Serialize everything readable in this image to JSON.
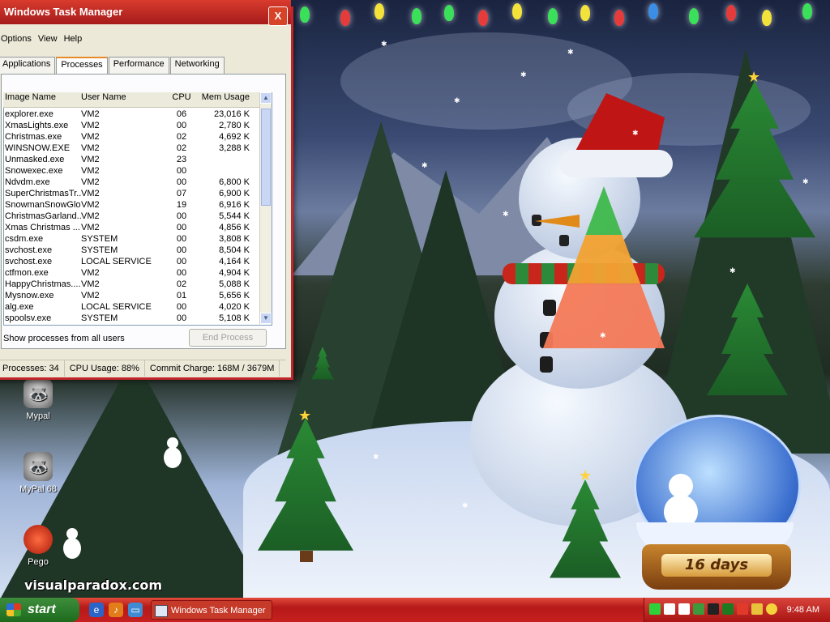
{
  "window": {
    "title": "Windows Task Manager",
    "close_label": "X",
    "menu": [
      "Options",
      "View",
      "Help"
    ],
    "tabs": [
      "Applications",
      "Processes",
      "Performance",
      "Networking"
    ],
    "active_tab": "Processes",
    "columns": {
      "name": "Image Name",
      "user": "User Name",
      "cpu": "CPU",
      "mem": "Mem Usage"
    },
    "processes": [
      {
        "name": "explorer.exe",
        "user": "VM2",
        "cpu": "06",
        "mem": "23,016 K"
      },
      {
        "name": "XmasLights.exe",
        "user": "VM2",
        "cpu": "00",
        "mem": "2,780 K"
      },
      {
        "name": "Christmas.exe",
        "user": "VM2",
        "cpu": "02",
        "mem": "4,692 K"
      },
      {
        "name": "WINSNOW.EXE",
        "user": "VM2",
        "cpu": "02",
        "mem": "3,288 K"
      },
      {
        "name": "Unmasked.exe",
        "user": "VM2",
        "cpu": "23",
        "mem": ""
      },
      {
        "name": "Snowexec.exe",
        "user": "VM2",
        "cpu": "00",
        "mem": ""
      },
      {
        "name": "Ndvdm.exe",
        "user": "VM2",
        "cpu": "00",
        "mem": "6,800 K"
      },
      {
        "name": "SuperChristmasTr...",
        "user": "VM2",
        "cpu": "07",
        "mem": "6,900 K"
      },
      {
        "name": "SnowmanSnowGlo...",
        "user": "VM2",
        "cpu": "19",
        "mem": "6,916 K"
      },
      {
        "name": "ChristmasGarland...",
        "user": "VM2",
        "cpu": "00",
        "mem": "5,544 K"
      },
      {
        "name": "Xmas Christmas ...",
        "user": "VM2",
        "cpu": "00",
        "mem": "4,856 K"
      },
      {
        "name": "csdm.exe",
        "user": "SYSTEM",
        "cpu": "00",
        "mem": "3,808 K"
      },
      {
        "name": "svchost.exe",
        "user": "SYSTEM",
        "cpu": "00",
        "mem": "8,504 K"
      },
      {
        "name": "svchost.exe",
        "user": "LOCAL SERVICE",
        "cpu": "00",
        "mem": "4,164 K"
      },
      {
        "name": "ctfmon.exe",
        "user": "VM2",
        "cpu": "00",
        "mem": "4,904 K"
      },
      {
        "name": "HappyChristmas....",
        "user": "VM2",
        "cpu": "02",
        "mem": "5,088 K"
      },
      {
        "name": "Mysnow.exe",
        "user": "VM2",
        "cpu": "01",
        "mem": "5,656 K"
      },
      {
        "name": "alg.exe",
        "user": "LOCAL SERVICE",
        "cpu": "00",
        "mem": "4,020 K"
      },
      {
        "name": "spoolsv.exe",
        "user": "SYSTEM",
        "cpu": "00",
        "mem": "5,108 K"
      }
    ],
    "show_all_label": "Show processes from all users",
    "end_process_label": "End Process",
    "status": {
      "processes": "Processes: 34",
      "cpu": "CPU Usage: 88%",
      "commit": "Commit Charge: 168M / 3679M"
    }
  },
  "desktop": {
    "icons": [
      {
        "label": "Mypal",
        "icon": "raccoon-icon"
      },
      {
        "label": "MyPal 68",
        "icon": "raccoon-icon"
      },
      {
        "label": "Pego",
        "icon": "pego-icon"
      }
    ],
    "countdown": "16 days",
    "watermark": "visualparadox.com"
  },
  "taskbar": {
    "start_label": "start",
    "task_label": "Windows Task Manager",
    "clock": "9:48 AM"
  },
  "colors": {
    "taskbar_red": "#c72020",
    "start_green": "#2d7d2b",
    "window_frame_red": "#c0262a"
  }
}
